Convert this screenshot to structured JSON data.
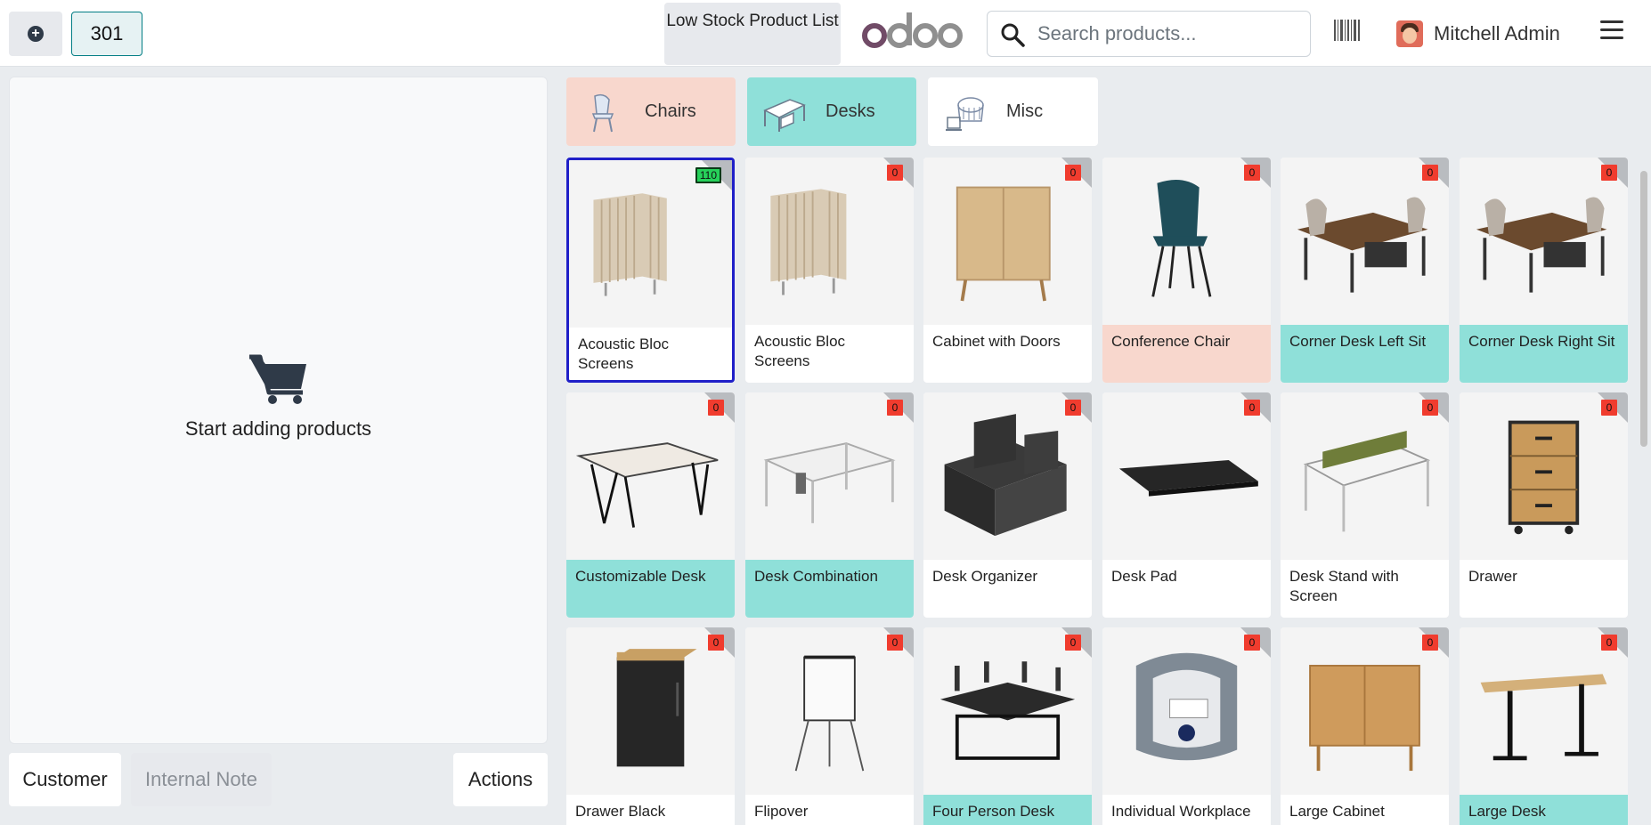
{
  "header": {
    "order_number": "301",
    "low_stock_label": "Low Stock Product List",
    "search_placeholder": "Search products...",
    "user_name": "Mitchell Admin"
  },
  "cart": {
    "empty_text": "Start adding products"
  },
  "bottom": {
    "customer": "Customer",
    "internal_note": "Internal Note",
    "actions": "Actions"
  },
  "categories": [
    {
      "label": "Chairs",
      "color": "#f8d7cd"
    },
    {
      "label": "Desks",
      "color": "#8fe0d9"
    },
    {
      "label": "Misc",
      "color": "#ffffff"
    }
  ],
  "products": [
    {
      "name": "Acoustic Bloc Screens",
      "qty": "110",
      "icon": "screen"
    },
    {
      "name": "Acoustic Bloc Screens",
      "qty": "0",
      "icon": "screen"
    },
    {
      "name": "Cabinet with Doors",
      "qty": "0",
      "icon": "cabinet"
    },
    {
      "name": "Conference Chair",
      "qty": "0",
      "icon": "chair"
    },
    {
      "name": "Corner Desk Left Sit",
      "qty": "0",
      "icon": "corner-desk"
    },
    {
      "name": "Corner Desk Right Sit",
      "qty": "0",
      "icon": "corner-desk"
    },
    {
      "name": "Customizable Desk",
      "qty": "0",
      "icon": "desk"
    },
    {
      "name": "Desk Combination",
      "qty": "0",
      "icon": "desk-combo"
    },
    {
      "name": "Desk Organizer",
      "qty": "0",
      "icon": "organizer"
    },
    {
      "name": "Desk Pad",
      "qty": "0",
      "icon": "pad"
    },
    {
      "name": "Desk Stand with Screen",
      "qty": "0",
      "icon": "stand"
    },
    {
      "name": "Drawer",
      "qty": "0",
      "icon": "drawer"
    },
    {
      "name": "Drawer Black",
      "qty": "0",
      "icon": "drawer-black"
    },
    {
      "name": "Flipover",
      "qty": "0",
      "icon": "flipover"
    },
    {
      "name": "Four Person Desk",
      "qty": "0",
      "icon": "four-desk"
    },
    {
      "name": "Individual Workplace",
      "qty": "0",
      "icon": "pod"
    },
    {
      "name": "Large Cabinet",
      "qty": "0",
      "icon": "large-cabinet"
    },
    {
      "name": "Large Desk",
      "qty": "0",
      "icon": "large-desk"
    }
  ]
}
